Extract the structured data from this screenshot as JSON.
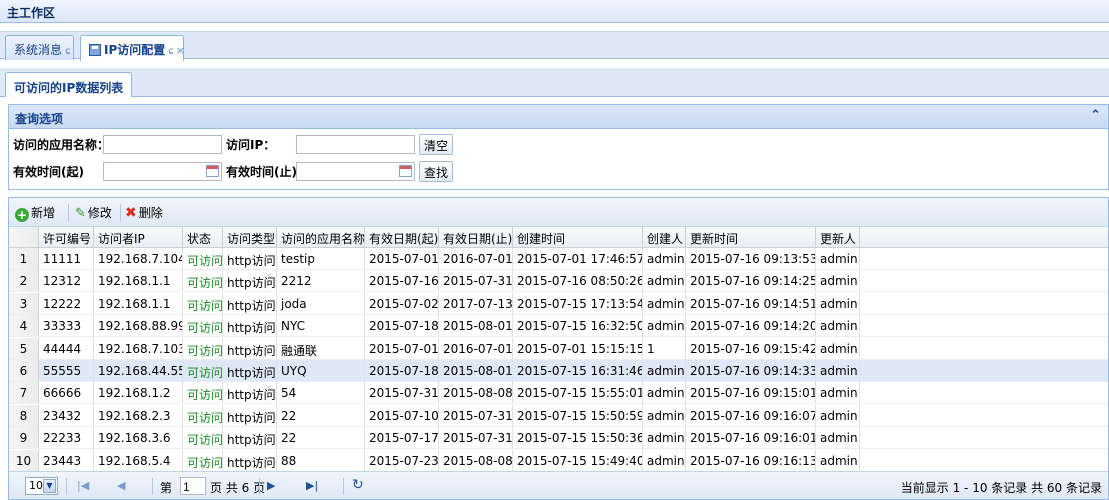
{
  "workspace": {
    "title": "主工作区"
  },
  "tabs": [
    {
      "label": "系统消息",
      "refresh_icon": "ɕ"
    },
    {
      "label": "IP访问配置",
      "refresh_icon": "ɕ",
      "close_icon": "×"
    }
  ],
  "subtab": {
    "label": "可访问的IP数据列表"
  },
  "query": {
    "title": "查询选项",
    "collapse_icon": "double-chevron-up-icon",
    "app_name_label": "访问的应用名称：",
    "app_name_value": "",
    "ip_label": "访问IP：",
    "ip_value": "",
    "start_label": "有效时间(起)",
    "start_value": "",
    "end_label": "有效时间(止)",
    "end_value": "",
    "clear_btn": "清空",
    "search_btn": "查找"
  },
  "toolbar": {
    "add_label": "新增",
    "edit_label": "修改",
    "delete_label": "删除"
  },
  "table": {
    "columns": [
      "许可编号",
      "访问者IP",
      "状态",
      "访问类型",
      "访问的应用名称",
      "有效日期(起)",
      "有效日期(止)",
      "创建时间",
      "创建人",
      "更新时间",
      "更新人"
    ],
    "rows": [
      {
        "n": "1",
        "id": "11111",
        "ip": "192.168.7.104",
        "status": "可访问",
        "type": "http访问",
        "app": "testip",
        "start": "2015-07-01",
        "end": "2016-07-01",
        "created": "2015-07-01 17:46:57",
        "creator": "admin",
        "updated": "2015-07-16 09:13:53",
        "updater": "admin"
      },
      {
        "n": "2",
        "id": "12312",
        "ip": "192.168.1.1",
        "status": "可访问",
        "type": "http访问",
        "app": "2212",
        "start": "2015-07-16",
        "end": "2015-07-31",
        "created": "2015-07-16 08:50:26",
        "creator": "admin",
        "updated": "2015-07-16 09:14:25",
        "updater": "admin"
      },
      {
        "n": "3",
        "id": "12222",
        "ip": "192.168.1.1",
        "status": "可访问",
        "type": "http访问",
        "app": "joda",
        "start": "2015-07-02",
        "end": "2017-07-13",
        "created": "2015-07-15 17:13:54",
        "creator": "admin",
        "updated": "2015-07-16 09:14:51",
        "updater": "admin"
      },
      {
        "n": "4",
        "id": "33333",
        "ip": "192.168.88.99",
        "status": "可访问",
        "type": "http访问",
        "app": "NYC",
        "start": "2015-07-18",
        "end": "2015-08-01",
        "created": "2015-07-15 16:32:50",
        "creator": "admin",
        "updated": "2015-07-16 09:14:20",
        "updater": "admin"
      },
      {
        "n": "5",
        "id": "44444",
        "ip": "192.168.7.103",
        "status": "可访问",
        "type": "http访问",
        "app": "融通联",
        "start": "2015-07-01",
        "end": "2016-07-01",
        "created": "2015-07-01 15:15:15",
        "creator": "1",
        "updated": "2015-07-16 09:15:42",
        "updater": "admin"
      },
      {
        "n": "6",
        "id": "55555",
        "ip": "192.168.44.55",
        "status": "可访问",
        "type": "http访问",
        "app": "UYQ",
        "start": "2015-07-18",
        "end": "2015-08-01",
        "created": "2015-07-15 16:31:46",
        "creator": "admin",
        "updated": "2015-07-16 09:14:33",
        "updater": "admin"
      },
      {
        "n": "7",
        "id": "66666",
        "ip": "192.168.1.2",
        "status": "可访问",
        "type": "http访问",
        "app": "54",
        "start": "2015-07-31",
        "end": "2015-08-08",
        "created": "2015-07-15 15:55:01",
        "creator": "admin",
        "updated": "2015-07-16 09:15:01",
        "updater": "admin"
      },
      {
        "n": "8",
        "id": "23432",
        "ip": "192.168.2.3",
        "status": "可访问",
        "type": "http访问",
        "app": "22",
        "start": "2015-07-10",
        "end": "2015-07-31",
        "created": "2015-07-15 15:50:59",
        "creator": "admin",
        "updated": "2015-07-16 09:16:07",
        "updater": "admin"
      },
      {
        "n": "9",
        "id": "22233",
        "ip": "192.168.3.6",
        "status": "可访问",
        "type": "http访问",
        "app": "22",
        "start": "2015-07-17",
        "end": "2015-07-31",
        "created": "2015-07-15 15:50:36",
        "creator": "admin",
        "updated": "2015-07-16 09:16:01",
        "updater": "admin"
      },
      {
        "n": "10",
        "id": "23443",
        "ip": "192.168.5.4",
        "status": "可访问",
        "type": "http访问",
        "app": "88",
        "start": "2015-07-23",
        "end": "2015-08-08",
        "created": "2015-07-15 15:49:40",
        "creator": "admin",
        "updated": "2015-07-16 09:16:13",
        "updater": "admin"
      }
    ],
    "selected_row": 6
  },
  "pager": {
    "page_size": "10",
    "page_prefix": "第",
    "current_page": "1",
    "page_suffix": "页 共 6 页",
    "info": "当前显示 1 - 10 条记录 共 60 条记录"
  },
  "colors": {
    "status_ok": "#1b8c23",
    "header_text": "#15428b",
    "selection": "#dfe8f6"
  }
}
